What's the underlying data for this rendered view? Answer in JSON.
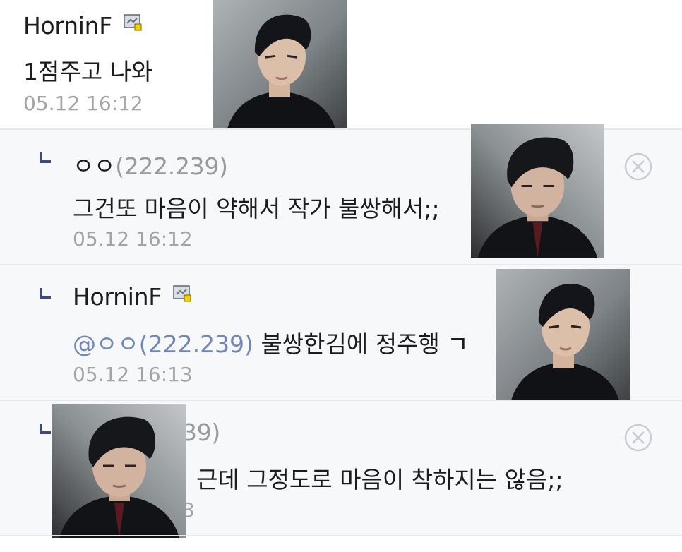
{
  "comments": [
    {
      "nickname": "HorninF",
      "message": "1점주고 나와",
      "time": "05.12 16:12",
      "icon": "fixed-nick-icon",
      "image": "portrait-man-longer-hair"
    },
    {
      "nickname": "ㅇㅇ",
      "ip": "(222.239)",
      "message": "그건또 마음이 약해서 작가 불쌍해서;;",
      "time": "05.12 16:12",
      "icon": "delete-icon",
      "image": "portrait-man-short-hair"
    },
    {
      "nickname": "HorninF",
      "mention": "@ㅇㅇ(222.239)",
      "message": "불쌍한김에 정주행 ㄱ",
      "time": "05.12 16:13",
      "icon": "fixed-nick-icon",
      "image": "portrait-man-longer-hair"
    },
    {
      "nickname_partial": "39)",
      "message": "근데 그정도로 마음이 착하지는 않음;;",
      "time_partial": "3",
      "icon": "delete-icon",
      "image": "portrait-man-short-hair"
    }
  ],
  "colors": {
    "reply_background": "#f7f8fa",
    "divider": "#e6e8ee",
    "mention": "#6f88b5",
    "reply_mark": "#3b4a7a",
    "timestamp": "#a4a4a4"
  }
}
